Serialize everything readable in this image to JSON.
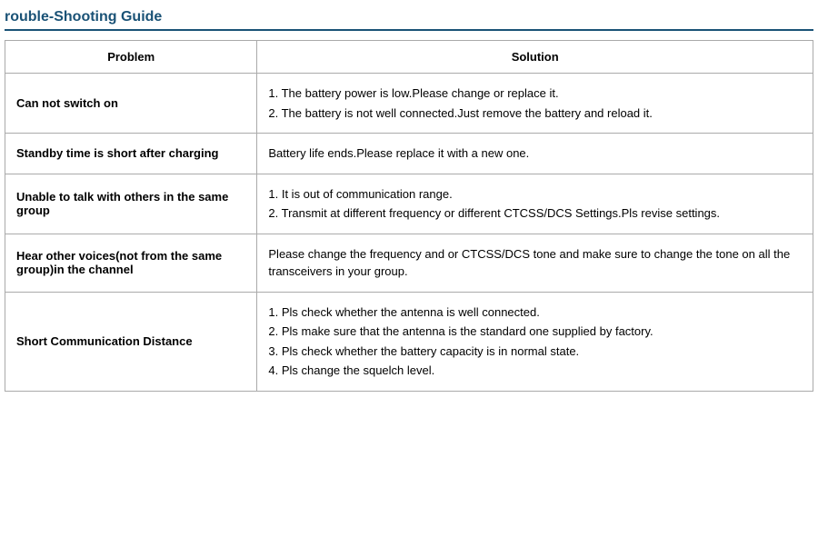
{
  "page": {
    "title": "rouble-Shooting Guide"
  },
  "table": {
    "headers": {
      "problem": "Problem",
      "solution": "Solution"
    },
    "rows": [
      {
        "problem": "Can not switch on",
        "solution_lines": [
          "1. The battery power is low.Please change or replace it.",
          "2. The battery is not well connected.Just remove the battery and reload it."
        ]
      },
      {
        "problem": "Standby time is short after charging",
        "solution_lines": [
          "Battery life ends.Please replace it with a new one."
        ]
      },
      {
        "problem": "Unable to talk with others in the same group",
        "solution_lines": [
          "1. It is out of communication range.",
          "2.  Transmit at different frequency or different CTCSS/DCS Settings.Pls revise settings."
        ]
      },
      {
        "problem": "Hear other voices(not from the same group)in the channel",
        "solution_lines": [
          "Please change the frequency and or CTCSS/DCS tone and make sure to change the tone on all the transceivers in your group."
        ]
      },
      {
        "problem": "Short Communication Distance",
        "solution_lines": [
          "1. Pls check whether the antenna is well connected.",
          "2. Pls make sure that the antenna is the standard one supplied by factory.",
          "3. Pls check whether the battery capacity is in normal state.",
          "4. Pls change the squelch level."
        ]
      }
    ]
  }
}
